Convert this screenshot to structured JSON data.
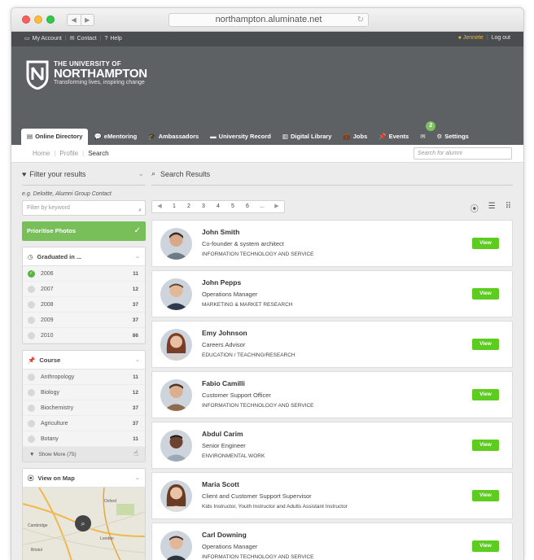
{
  "browser": {
    "url": "northampton.aluminate.net"
  },
  "topbar": {
    "my_account": "My Account",
    "contact": "Contact",
    "help": "Help",
    "user": "Jennete",
    "logout": "Log out"
  },
  "brand": {
    "line1": "THE UNIVERSITY OF",
    "line2": "NORTHAMPTON",
    "tagline": "Transforming lives, inspiring change"
  },
  "nav": {
    "items": [
      "Online Directory",
      "eMentoring",
      "Ambassadors",
      "University Record",
      "Digital Library",
      "Jobs",
      "Events",
      "",
      "Settings"
    ],
    "messages_badge": "2"
  },
  "breadcrumb": {
    "home": "Home",
    "profile": "Profile",
    "search": "Search"
  },
  "alumni_search": {
    "placeholder": "Search for alumni"
  },
  "filter": {
    "title": "Filter your results",
    "hint": "e.g. Deloitte, Alumni Group Contact",
    "keyword_placeholder": "Filter by keyword",
    "prioritise": "Prioritise Photos",
    "graduated": {
      "title": "Graduated in ...",
      "options": [
        {
          "label": "2006",
          "count": "11"
        },
        {
          "label": "2007",
          "count": "12"
        },
        {
          "label": "2008",
          "count": "37"
        },
        {
          "label": "2009",
          "count": "37"
        },
        {
          "label": "2010",
          "count": "86"
        }
      ]
    },
    "course": {
      "title": "Course",
      "options": [
        {
          "label": "Anthropology",
          "count": "11"
        },
        {
          "label": "Biology",
          "count": "12"
        },
        {
          "label": "Biochemistry",
          "count": "37"
        },
        {
          "label": "Agriculture",
          "count": "37"
        },
        {
          "label": "Botany",
          "count": "11"
        }
      ],
      "show_more": "Show More (75)"
    },
    "map": {
      "title": "View on Map",
      "labels": [
        "Cambridge",
        "Oxford",
        "London",
        "Bristol"
      ]
    }
  },
  "results": {
    "title": "Search Results",
    "pages": [
      "1",
      "2",
      "3",
      "4",
      "5",
      "6",
      "..."
    ],
    "view_label": "View",
    "people": [
      {
        "name": "John Smith",
        "role": "Co-founder & system architect",
        "dept": "INFORMATION TECHNOLOGY AND SERVICE"
      },
      {
        "name": "John Pepps",
        "role": "Operations Manager",
        "dept": "MARKETING & MARKET RESEARCH"
      },
      {
        "name": "Emy Johnson",
        "role": "Careers Advisor",
        "dept": "EDUCATION / TEACHING/RESEARCH"
      },
      {
        "name": "Fabio Camilli",
        "role": "Customer Support Officer",
        "dept": "INFORMATION TECHNOLOGY AND SERVICE"
      },
      {
        "name": "Abdul Carim",
        "role": "Senior Engineer",
        "dept": "ENVIRONMENTAL WORK"
      },
      {
        "name": "Maria Scott",
        "role": "Client and Customer Support Supervisor",
        "dept": "Kids Instructor, Youth Instructor and Adults Assistant Instructor"
      },
      {
        "name": "Carl Downing",
        "role": "Operations Manager",
        "dept": "INFORMATION TECHNOLOGY AND SERVICE"
      }
    ]
  },
  "colors": {
    "accent_green": "#78bf5a",
    "view_green": "#5ccc1e",
    "header_gray": "#5e6164",
    "user_gold": "#f2b431"
  }
}
